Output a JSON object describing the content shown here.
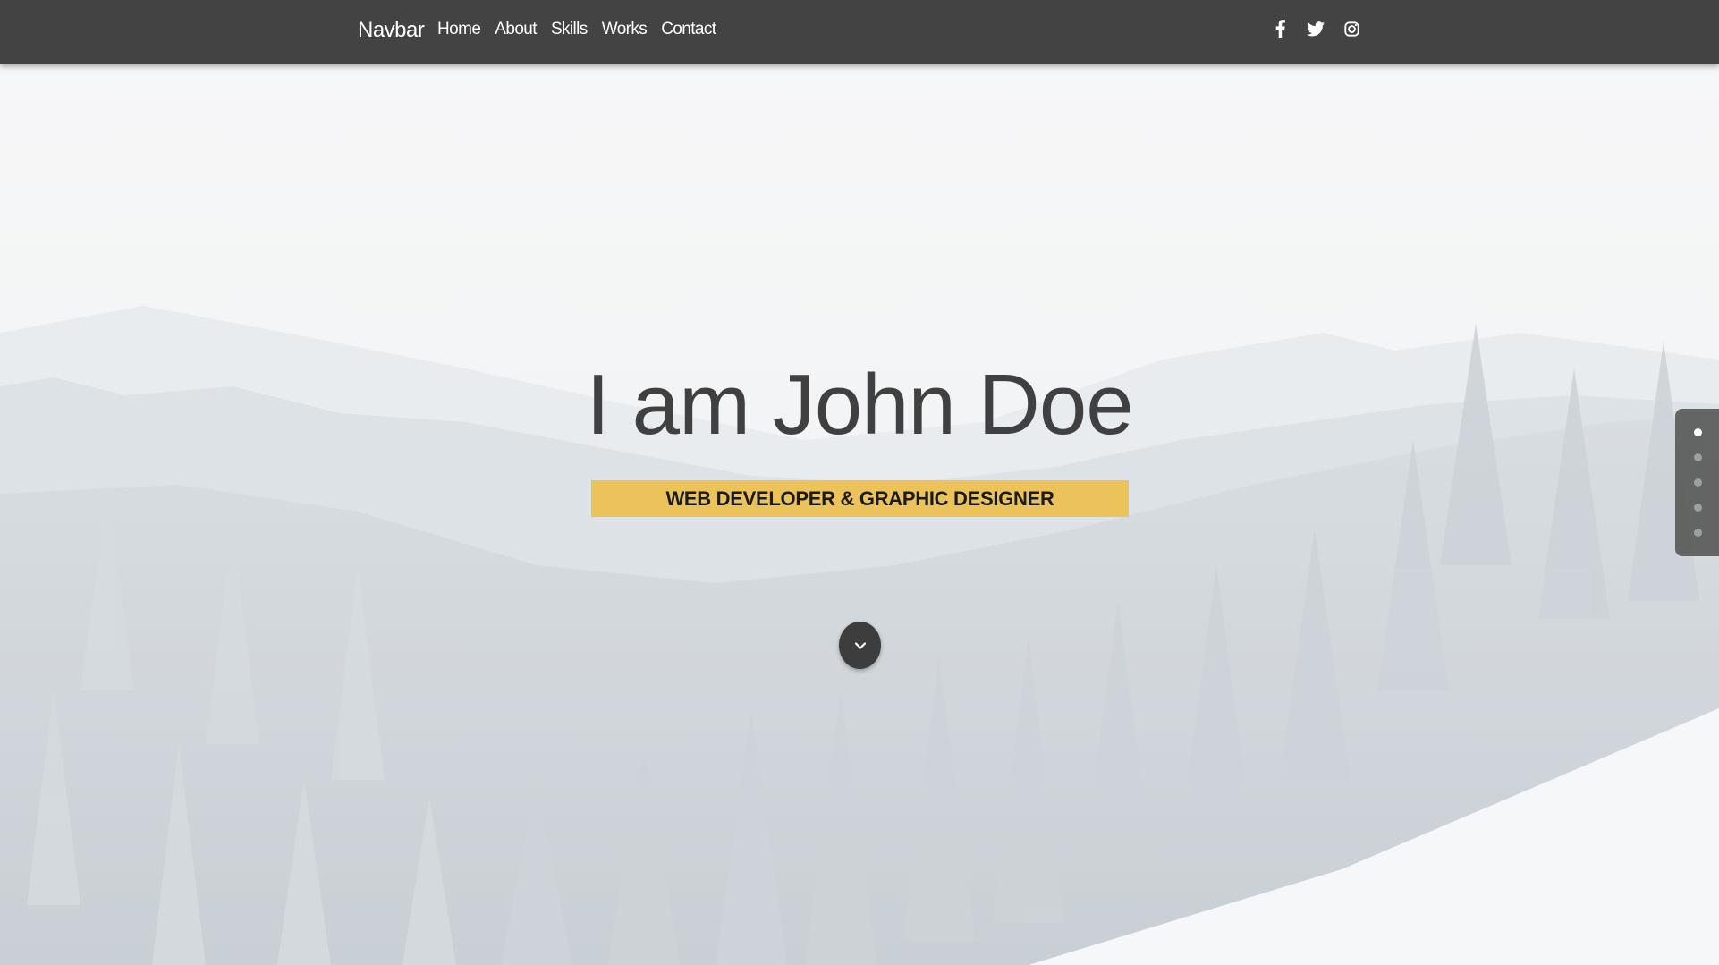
{
  "navbar": {
    "brand": "Navbar",
    "links": [
      {
        "label": "Home"
      },
      {
        "label": "About"
      },
      {
        "label": "Skills"
      },
      {
        "label": "Works"
      },
      {
        "label": "Contact"
      }
    ],
    "social": [
      {
        "icon": "facebook-icon"
      },
      {
        "icon": "twitter-icon"
      },
      {
        "icon": "instagram-icon"
      }
    ]
  },
  "hero": {
    "title": "I am John Doe",
    "subtitle": "WEB DEVELOPER & GRAPHIC DESIGNER",
    "scroll_icon": "chevron-down-icon"
  },
  "side_nav": {
    "count": 5,
    "active_index": 0
  },
  "colors": {
    "navbar_bg": "#434343",
    "accent": "#ecc35a",
    "title_text": "#404040"
  }
}
